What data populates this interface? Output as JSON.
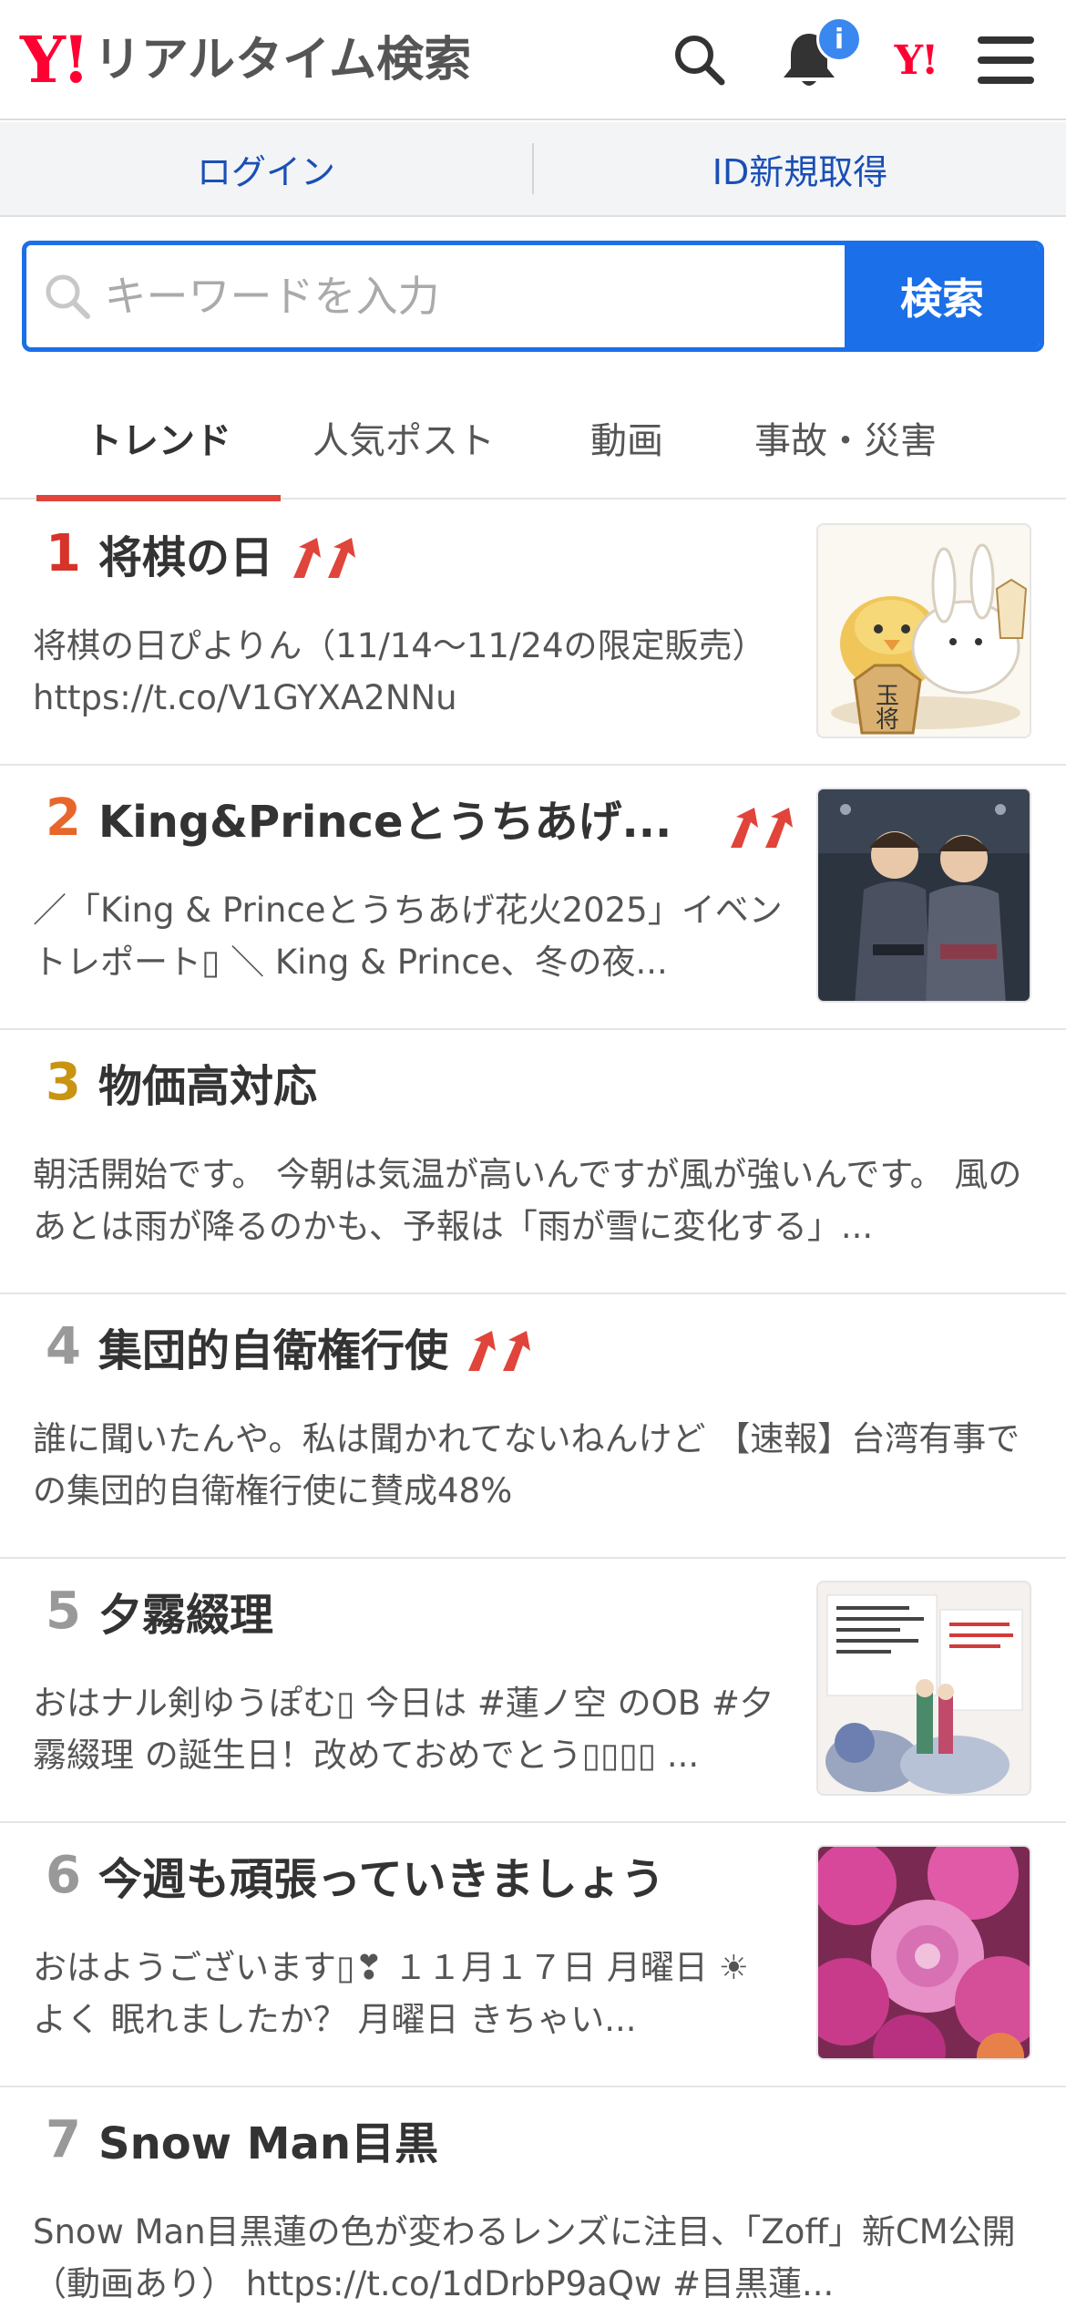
{
  "header": {
    "logo_mark": "Y!",
    "logo_title": "リアルタイム検索",
    "notification_count": "i",
    "yj_mark": "Y!"
  },
  "login_bar": {
    "login_label": "ログイン",
    "signup_label": "ID新規取得"
  },
  "search": {
    "placeholder": "キーワードを入力",
    "button_label": "検索"
  },
  "tabs": [
    {
      "label": "トレンド",
      "active": true
    },
    {
      "label": "人気ポスト",
      "active": false
    },
    {
      "label": "動画",
      "active": false
    },
    {
      "label": "事故・災害",
      "active": false
    }
  ],
  "trends": [
    {
      "rank": "1",
      "title": "将棋の日",
      "rising": true,
      "text": "将棋の日ぴよりん（11/14〜11/24の限定販売） https://t.co/V1GYXA2NNu",
      "thumbnail": "shogi-piyorin-image"
    },
    {
      "rank": "2",
      "title": "King&Princeとうちあげ...",
      "rising": true,
      "text": "／「King & Princeとうちあげ花火2025」イベントレポート▯ ＼ King & Prince、冬の夜...",
      "thumbnail": "king-and-prince-photo"
    },
    {
      "rank": "3",
      "title": "物価高対応",
      "rising": false,
      "text": "朝活開始です。 今朝は気温が高いんですが風が強いんです。 風のあとは雨が降るのかも、予報は「雨が雪に変化する」...",
      "thumbnail": ""
    },
    {
      "rank": "4",
      "title": "集団的自衛権行使",
      "rising": true,
      "text": "誰に聞いたんや。私は聞かれてないねんけど 【速報】台湾有事での集団的自衛権行使に賛成48%",
      "thumbnail": ""
    },
    {
      "rank": "5",
      "title": "夕霧綴理",
      "rising": false,
      "text": "おはナル剣ゆうぽむ▯ 今日は #蓮ノ空 のOB #夕霧綴理 の誕生日！改めておめでとう▯▯▯▯ ...",
      "thumbnail": "figures-birthday-photo"
    },
    {
      "rank": "6",
      "title": "今週も頑張っていきましょう",
      "rising": false,
      "text": "おはようございます▯❣ １１月１７日 月曜日 ☀ よく 眠れましたか？ 月曜日 きちゃい...",
      "thumbnail": "pink-flowers-photo"
    },
    {
      "rank": "7",
      "title": "Snow Man目黒",
      "rising": false,
      "text": "Snow Man目黒蓮の色が変わるレンズに注目、「Zoff」新CM公開（動画あり） https://t.co/1dDrbP9aQw #目黒蓮...",
      "thumbnail": ""
    }
  ],
  "colors": {
    "accent_blue": "#1b6fe8",
    "logo_red": "#ff0033",
    "rising_arrow": "#e0443a",
    "active_tab_underline": "#e0443a"
  }
}
